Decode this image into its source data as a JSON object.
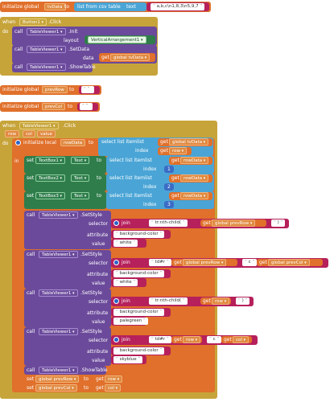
{
  "globals": {
    "init_kw": "initialize global",
    "to": "to",
    "tvData": {
      "name": "tvData",
      "list_label": "list from csv table",
      "text_label": "text",
      "text_value": "a,b,c\\n1,8,3\\n5,9,7"
    },
    "prevRow": {
      "name": "prevRow",
      "value": ""
    },
    "prevCol": {
      "name": "prevCol",
      "value": ""
    }
  },
  "button_click": {
    "when": "when",
    "component": "Button1",
    "event": ".Click",
    "do": "do",
    "init_call": "call",
    "init_comp": "TableViewer1",
    "init_method": ".Init",
    "layout_label": "layout",
    "layout_value": "VerticalArrangement1",
    "setdata_comp": "TableViewer1",
    "setdata_method": ".SetData",
    "data_label": "data",
    "get": "get",
    "get_var": "global tvData",
    "show_comp": "TableViewer1",
    "show_method": ".ShowTable"
  },
  "tv_click": {
    "when": "when",
    "component": "TableViewer1",
    "event": ".Click",
    "params": [
      "row",
      "col",
      "value"
    ],
    "do": "do",
    "init_local": "initialize local",
    "local_name": "rowData",
    "to": "to",
    "select_list_item": "select list item",
    "list": "list",
    "index": "index",
    "get_tvdata": "global tvData",
    "get_row": "row",
    "in": "in",
    "set_rows": [
      {
        "set": "set",
        "comp": "TextBox1",
        "prop": "Text",
        "to": "to",
        "get_var": "rowData",
        "index": "1"
      },
      {
        "set": "set",
        "comp": "TextBox2",
        "prop": "Text",
        "to": "to",
        "get_var": "rowData",
        "index": "2"
      },
      {
        "set": "set",
        "comp": "TextBox3",
        "prop": "Text",
        "to": "to",
        "get_var": "rowData",
        "index": "3"
      }
    ],
    "setstyle_blocks": [
      {
        "comp": "TableViewer1",
        "method": ".SetStyle",
        "selector_parts": [
          "tr:nth-child(",
          "global prevRow",
          ")"
        ],
        "attribute": "background-color",
        "value": "white"
      },
      {
        "comp": "TableViewer1",
        "method": ".SetStyle",
        "selector_parts": [
          "td#r",
          "global prevRow",
          "c",
          "global prevCol"
        ],
        "attribute": "background-color",
        "value": "white"
      },
      {
        "comp": "TableViewer1",
        "method": ".SetStyle",
        "selector_parts": [
          "tr:nth-child(",
          "row",
          ")"
        ],
        "attribute": "background-color",
        "value": "palegreen"
      },
      {
        "comp": "TableViewer1",
        "method": ".SetStyle",
        "selector_parts": [
          "td#r",
          "row",
          "c",
          "col"
        ],
        "attribute": "background-color",
        "value": "skyblue"
      }
    ],
    "call": "call",
    "selector": "selector",
    "attribute": "attribute",
    "value": "value",
    "join": "join",
    "show_comp": "TableViewer1",
    "show_method": ".ShowTable",
    "final_sets": [
      {
        "set": "set",
        "var": "global prevRow",
        "to": "to",
        "get": "get",
        "get_var": "row"
      },
      {
        "set": "set",
        "var": "global prevCol",
        "to": "to",
        "get": "get",
        "get_var": "col"
      }
    ]
  },
  "colors": {
    "variable": "#e0702b",
    "event": "#c7a43a",
    "component": "#6b4a9b",
    "list": "#4aa5d6",
    "text": "#b6205b",
    "set": "#2f7d4b"
  }
}
